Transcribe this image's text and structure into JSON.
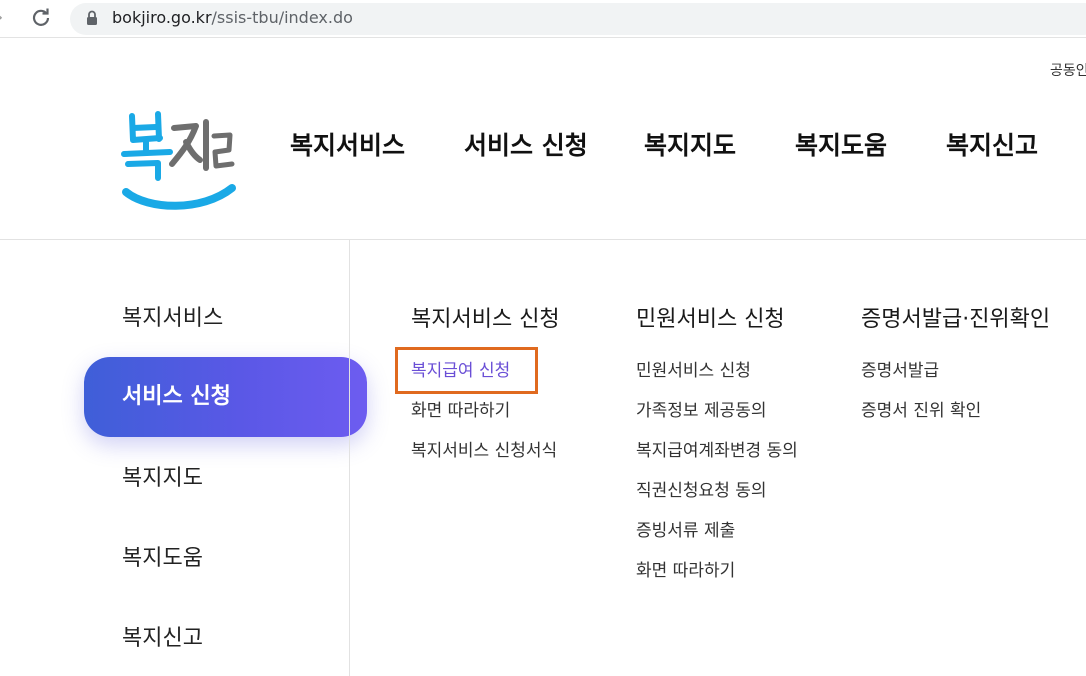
{
  "browser": {
    "url_host": "bokjiro.go.kr",
    "url_path": "/ssis-tbu/index.do"
  },
  "header": {
    "util_link": "공동인",
    "logo_text": "복지로",
    "gnb": [
      "복지서비스",
      "서비스 신청",
      "복지지도",
      "복지도움",
      "복지신고"
    ]
  },
  "side_menu": {
    "items": [
      "복지서비스",
      "서비스 신청",
      "복지지도",
      "복지도움",
      "복지신고"
    ],
    "active_index": 1
  },
  "submenu": {
    "columns": [
      {
        "title": "복지서비스 신청",
        "links": [
          "복지급여 신청",
          "화면 따라하기",
          "복지서비스 신청서식"
        ]
      },
      {
        "title": "민원서비스 신청",
        "links": [
          "민원서비스 신청",
          "가족정보 제공동의",
          "복지급여계좌변경 동의",
          "직권신청요청 동의",
          "증빙서류 제출",
          "화면 따라하기"
        ]
      },
      {
        "title": "증명서발급·진위확인",
        "links": [
          "증명서발급",
          "증명서 진위 확인"
        ]
      }
    ],
    "highlighted_link": "복지급여 신청"
  },
  "colors": {
    "brand_blue": "#1aa9e6",
    "active_gradient_start": "#3f5fd8",
    "active_gradient_end": "#6d5cf0",
    "highlight_border": "#e06a1f",
    "highlight_text": "#6a4fd6"
  },
  "icons": [
    "forward-arrow-icon",
    "reload-icon",
    "lock-icon"
  ]
}
